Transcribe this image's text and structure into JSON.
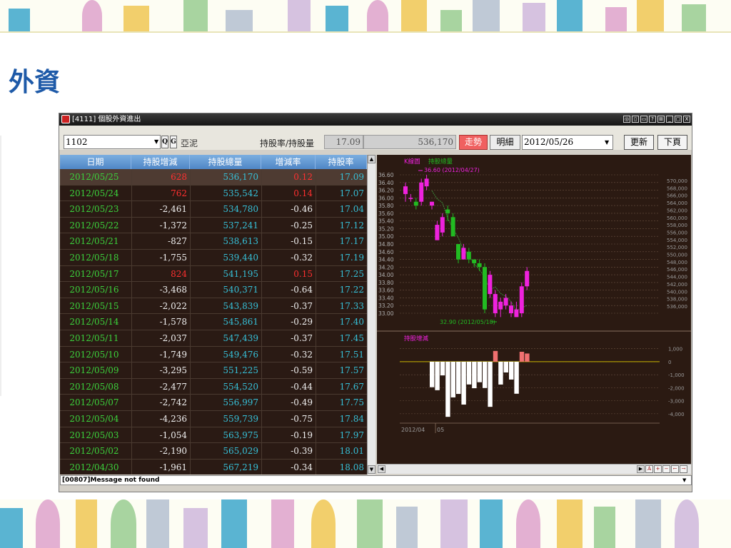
{
  "slide": {
    "title": "外資"
  },
  "window": {
    "title": "[4111] 個股外資進出",
    "controls": [
      "◎",
      "▯",
      "▭",
      "?",
      "⊞",
      "_",
      "▢",
      "X"
    ]
  },
  "toolbar": {
    "stock_code": "1102",
    "q_label": "Q",
    "g_label": "G",
    "stock_name": "亞泥",
    "ratio_label": "持股率/持股量",
    "ratio_value": "17.09",
    "amount_value": "536,170",
    "trend_label": "走勢",
    "detail_label": "明細",
    "date_value": "2012/05/26",
    "refresh_label": "更新",
    "next_label": "下頁"
  },
  "grid": {
    "headers": [
      "日期",
      "持股增減",
      "持股總量",
      "增減率",
      "持股率"
    ],
    "rows": [
      [
        "2012/05/25",
        "628",
        "536,170",
        "0.12",
        "17.09"
      ],
      [
        "2012/05/24",
        "762",
        "535,542",
        "0.14",
        "17.07"
      ],
      [
        "2012/05/23",
        "-2,461",
        "534,780",
        "-0.46",
        "17.04"
      ],
      [
        "2012/05/22",
        "-1,372",
        "537,241",
        "-0.25",
        "17.12"
      ],
      [
        "2012/05/21",
        "-827",
        "538,613",
        "-0.15",
        "17.17"
      ],
      [
        "2012/05/18",
        "-1,755",
        "539,440",
        "-0.32",
        "17.19"
      ],
      [
        "2012/05/17",
        "824",
        "541,195",
        "0.15",
        "17.25"
      ],
      [
        "2012/05/16",
        "-3,468",
        "540,371",
        "-0.64",
        "17.22"
      ],
      [
        "2012/05/15",
        "-2,022",
        "543,839",
        "-0.37",
        "17.33"
      ],
      [
        "2012/05/14",
        "-1,578",
        "545,861",
        "-0.29",
        "17.40"
      ],
      [
        "2012/05/11",
        "-2,037",
        "547,439",
        "-0.37",
        "17.45"
      ],
      [
        "2012/05/10",
        "-1,749",
        "549,476",
        "-0.32",
        "17.51"
      ],
      [
        "2012/05/09",
        "-3,295",
        "551,225",
        "-0.59",
        "17.57"
      ],
      [
        "2012/05/08",
        "-2,477",
        "554,520",
        "-0.44",
        "17.67"
      ],
      [
        "2012/05/07",
        "-2,742",
        "556,997",
        "-0.49",
        "17.75"
      ],
      [
        "2012/05/04",
        "-4,236",
        "559,739",
        "-0.75",
        "17.84"
      ],
      [
        "2012/05/03",
        "-1,054",
        "563,975",
        "-0.19",
        "17.97"
      ],
      [
        "2012/05/02",
        "-2,190",
        "565,029",
        "-0.39",
        "18.01"
      ],
      [
        "2012/04/30",
        "-1,961",
        "567,219",
        "-0.34",
        "18.08"
      ]
    ]
  },
  "chart": {
    "legend_top": [
      "K線圖",
      "持股總量"
    ],
    "legend_bottom": "持股增減",
    "high_annotation": "36.60 (2012/04/27)",
    "low_annotation": "32.90 (2012/05/18)",
    "price_ticks": [
      "36.60",
      "36.40",
      "36.20",
      "36.00",
      "35.80",
      "35.60",
      "35.40",
      "35.20",
      "35.00",
      "34.80",
      "34.60",
      "34.40",
      "34.20",
      "34.00",
      "33.80",
      "33.60",
      "33.40",
      "33.20",
      "33.00"
    ],
    "holding_ticks": [
      "570,000",
      "568,000",
      "566,000",
      "564,000",
      "562,000",
      "560,000",
      "558,000",
      "556,000",
      "554,000",
      "552,000",
      "550,000",
      "548,000",
      "546,000",
      "544,000",
      "542,000",
      "540,000",
      "538,000",
      "536,000"
    ],
    "change_ticks": [
      "1,000",
      "0",
      "-1,000",
      "-2,000",
      "-3,000",
      "-4,000"
    ],
    "x_ticks": [
      "2012/04",
      "05"
    ],
    "colors": {
      "up": "#ee22dd",
      "down": "#22bb22",
      "bar_up": "#f07070",
      "bar_down": "#ffffff",
      "zero_line": "#c8b400",
      "grid": "#6a5040"
    }
  },
  "chart_data": [
    {
      "type": "candlestick",
      "title": "",
      "xlabel": "",
      "ylabel": "",
      "ylim": [
        33.0,
        36.6
      ],
      "x": [
        "2012/04/23",
        "2012/04/24",
        "2012/04/25",
        "2012/04/26",
        "2012/04/27",
        "2012/04/30",
        "2012/05/02",
        "2012/05/03",
        "2012/05/04",
        "2012/05/07",
        "2012/05/08",
        "2012/05/09",
        "2012/05/10",
        "2012/05/11",
        "2012/05/14",
        "2012/05/15",
        "2012/05/16",
        "2012/05/17",
        "2012/05/18",
        "2012/05/21",
        "2012/05/22",
        "2012/05/23",
        "2012/05/24",
        "2012/05/25"
      ],
      "open": [
        36.1,
        36.0,
        35.9,
        35.9,
        36.3,
        35.8,
        34.9,
        35.1,
        35.7,
        35.5,
        34.8,
        34.4,
        34.6,
        34.4,
        34.3,
        34.2,
        33.5,
        33.0,
        33.1,
        33.2,
        33.0,
        32.9,
        33.0,
        33.7
      ],
      "close": [
        36.3,
        36.0,
        35.8,
        36.4,
        36.5,
        35.9,
        35.3,
        35.5,
        35.6,
        35.0,
        34.4,
        34.7,
        34.4,
        34.3,
        34.2,
        33.1,
        34.0,
        33.5,
        33.3,
        33.4,
        33.2,
        33.1,
        33.7,
        34.1
      ],
      "high": [
        36.4,
        36.1,
        36.0,
        36.5,
        36.6,
        35.9,
        35.4,
        35.6,
        35.8,
        35.6,
        34.8,
        34.8,
        34.7,
        34.4,
        34.4,
        34.3,
        34.1,
        33.6,
        33.4,
        33.5,
        33.3,
        33.3,
        33.8,
        34.2
      ],
      "low": [
        35.9,
        35.9,
        35.7,
        35.8,
        36.2,
        35.7,
        34.9,
        35.0,
        35.4,
        35.0,
        34.3,
        34.4,
        34.3,
        34.2,
        34.1,
        33.0,
        33.4,
        32.9,
        32.9,
        33.1,
        32.9,
        32.9,
        32.9,
        33.6
      ]
    },
    {
      "type": "line",
      "title": "",
      "xlabel": "",
      "ylabel": "",
      "ylim": [
        536000,
        570000
      ],
      "x": [
        "2012/04/30",
        "2012/05/02",
        "2012/05/03",
        "2012/05/04",
        "2012/05/07",
        "2012/05/08",
        "2012/05/09",
        "2012/05/10",
        "2012/05/11",
        "2012/05/14",
        "2012/05/15",
        "2012/05/16",
        "2012/05/17",
        "2012/05/18",
        "2012/05/21",
        "2012/05/22",
        "2012/05/23",
        "2012/05/24",
        "2012/05/25"
      ],
      "series": [
        {
          "name": "持股總量",
          "values": [
            567219,
            565029,
            563975,
            559739,
            556997,
            554520,
            551225,
            549476,
            547439,
            545861,
            543839,
            540371,
            541195,
            539440,
            538613,
            537241,
            534780,
            535542,
            536170
          ]
        }
      ]
    },
    {
      "type": "bar",
      "title": "",
      "xlabel": "",
      "ylabel": "",
      "ylim": [
        -4500,
        1200
      ],
      "x": [
        "2012/04/30",
        "2012/05/02",
        "2012/05/03",
        "2012/05/04",
        "2012/05/07",
        "2012/05/08",
        "2012/05/09",
        "2012/05/10",
        "2012/05/11",
        "2012/05/14",
        "2012/05/15",
        "2012/05/16",
        "2012/05/17",
        "2012/05/18",
        "2012/05/21",
        "2012/05/22",
        "2012/05/23",
        "2012/05/24",
        "2012/05/25"
      ],
      "series": [
        {
          "name": "持股增減",
          "values": [
            -1961,
            -2190,
            -1054,
            -4236,
            -2742,
            -2477,
            -3295,
            -1749,
            -2037,
            -1578,
            -2022,
            -3468,
            824,
            -1755,
            -827,
            -1372,
            -2461,
            762,
            628
          ]
        }
      ]
    }
  ],
  "status": {
    "message": "[00807]Message not found"
  }
}
